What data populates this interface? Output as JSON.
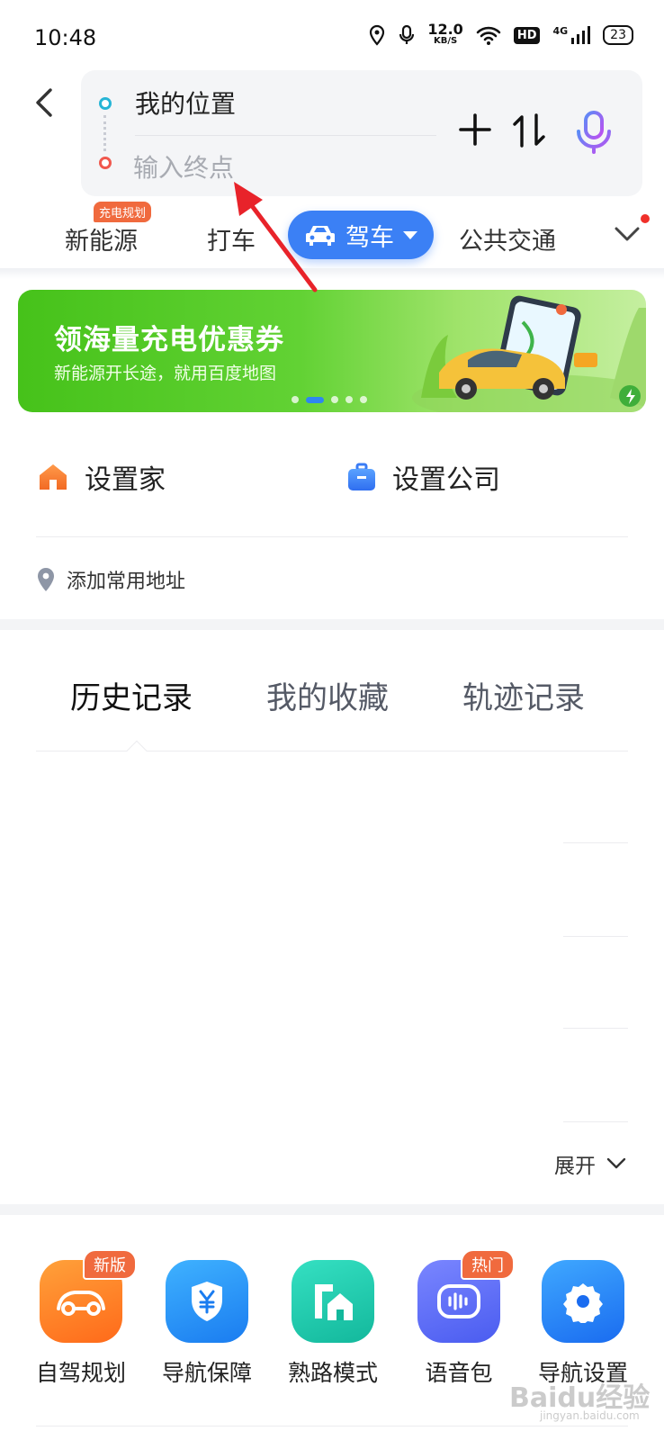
{
  "status_bar": {
    "time": "10:48",
    "net_speed": "12.0",
    "net_speed_unit": "KB/S",
    "hd": "HD",
    "network": "4G",
    "battery": "23"
  },
  "route": {
    "start": "我的位置",
    "end_placeholder": "输入终点"
  },
  "modes": {
    "badge": "充电规划",
    "new_energy": "新能源",
    "taxi": "打车",
    "drive": "驾车",
    "transit": "公共交通"
  },
  "banner": {
    "title": "领海量充电优惠券",
    "subtitle": "新能源开长途，就用百度地图"
  },
  "quick": {
    "home": "设置家",
    "company": "设置公司",
    "add_address": "添加常用地址"
  },
  "history_tabs": {
    "history": "历史记录",
    "favorites": "我的收藏",
    "tracks": "轨迹记录"
  },
  "expand_label": "展开",
  "tools": [
    {
      "label": "自驾规划",
      "badge": "新版"
    },
    {
      "label": "导航保障",
      "badge": ""
    },
    {
      "label": "熟路模式",
      "badge": ""
    },
    {
      "label": "语音包",
      "badge": "热门"
    },
    {
      "label": "导航设置",
      "badge": ""
    }
  ],
  "watermark": {
    "text": "Baidu经验",
    "sub": "jingyan.baidu.com"
  },
  "colors": {
    "accent": "#3b80f5",
    "badge": "#f06a3e",
    "start_dot": "#26b5d6",
    "end_dot": "#f0584e",
    "banner_green": "#46c21a",
    "annotation_arrow": "#e8232a"
  }
}
